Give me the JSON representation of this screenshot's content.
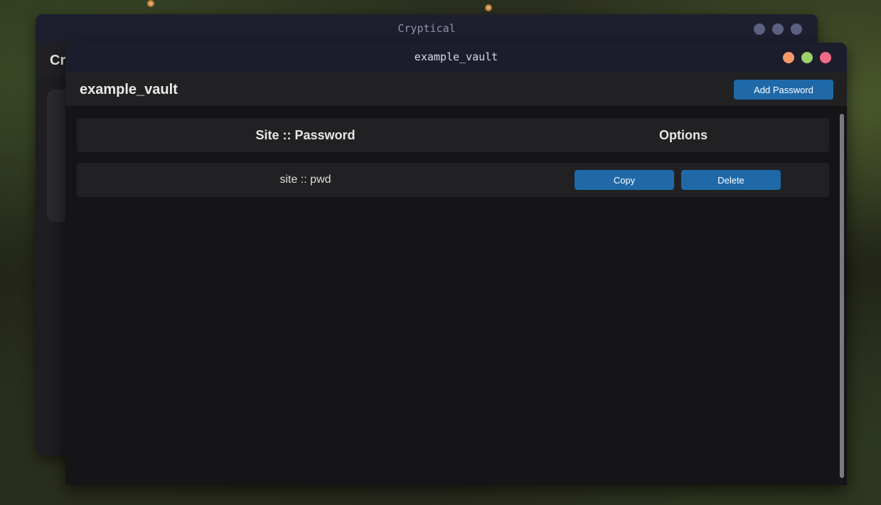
{
  "back_window": {
    "title": "Cryptical",
    "header_text": "Cr"
  },
  "front_window": {
    "title": "example_vault",
    "vault_name": "example_vault",
    "add_button_label": "Add Password"
  },
  "table": {
    "headers": {
      "site_password": "Site :: Password",
      "options": "Options"
    },
    "rows": [
      {
        "entry": "site :: pwd",
        "copy_label": "Copy",
        "delete_label": "Delete"
      }
    ]
  },
  "colors": {
    "accent": "#1f69a8",
    "dot_orange": "#f49a6a",
    "dot_green": "#9bd06a",
    "dot_red": "#f06a87"
  }
}
